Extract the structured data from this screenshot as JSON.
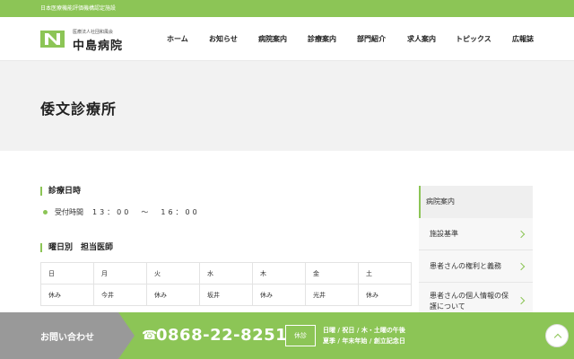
{
  "topbar": {
    "text": "日本医療機能評価機構認定施設"
  },
  "logo": {
    "subtitle": "医療法人社団和風会",
    "name": "中島病院",
    "mark_letter": "N"
  },
  "nav": [
    "ホーム",
    "お知らせ",
    "病院案内",
    "診療案内",
    "部門紹介",
    "求人案内",
    "トピックス",
    "広報誌"
  ],
  "hero": {
    "title": "倭文診療所"
  },
  "hours_section": {
    "title": "診療日時",
    "label": "受付時間",
    "value": "13：00　〜　16：00"
  },
  "schedule_section": {
    "title": "曜日別　担当医師",
    "days": [
      "日",
      "月",
      "火",
      "水",
      "木",
      "金",
      "土"
    ],
    "doctors": [
      "休み",
      "今井",
      "休み",
      "坂井",
      "休み",
      "光井",
      "休み"
    ]
  },
  "sidebar": {
    "heading": "病院案内",
    "items": [
      "施設基準",
      "患者さんの権利と義務",
      "患者さんの個人情報の保護について"
    ]
  },
  "footer": {
    "contact": "お問い合わせ",
    "phone_icon": "phone-icon",
    "phone": "0868-22-8251",
    "closed_label": "休診",
    "closed_days_1": "日曜 / 祝日 / 木・土曜の午後",
    "closed_days_2": "夏季 / 年末年始 / 創立記念日"
  },
  "colors": {
    "accent": "#8cc556",
    "footer_gray": "#999999",
    "hero_bg": "#f2f2f2"
  }
}
